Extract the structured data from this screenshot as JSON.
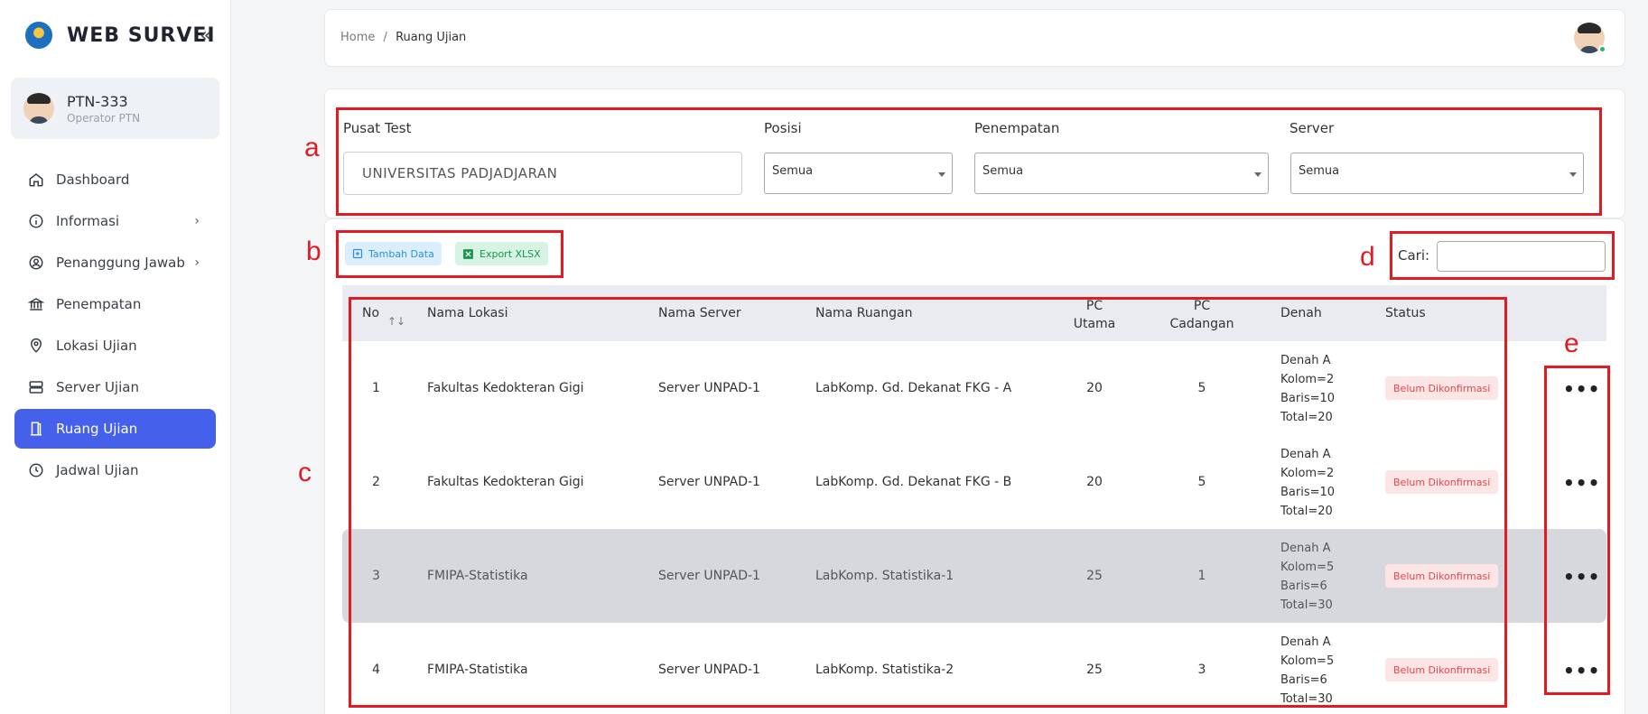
{
  "app": {
    "title": "WEB SURVEI",
    "collapse_icon": "chevrons-left-icon"
  },
  "user": {
    "name": "PTN-333",
    "role": "Operator PTN"
  },
  "nav": [
    {
      "label": "Dashboard",
      "icon": "home-icon",
      "active": false,
      "has_chevron": false
    },
    {
      "label": "Informasi",
      "icon": "info-icon",
      "active": false,
      "has_chevron": true
    },
    {
      "label": "Penanggung Jawab",
      "icon": "user-circle-icon",
      "active": false,
      "has_chevron": true
    },
    {
      "label": "Penempatan",
      "icon": "bank-icon",
      "active": false,
      "has_chevron": false
    },
    {
      "label": "Lokasi Ujian",
      "icon": "map-pin-icon",
      "active": false,
      "has_chevron": false
    },
    {
      "label": "Server Ujian",
      "icon": "server-icon",
      "active": false,
      "has_chevron": false
    },
    {
      "label": "Ruang Ujian",
      "icon": "door-icon",
      "active": true,
      "has_chevron": false
    },
    {
      "label": "Jadwal Ujian",
      "icon": "clock-icon",
      "active": false,
      "has_chevron": false
    }
  ],
  "breadcrumb": {
    "home": "Home",
    "separator": "/",
    "current": "Ruang Ujian"
  },
  "filters": {
    "pusat_test": {
      "label": "Pusat Test",
      "value": "UNIVERSITAS PADJADJARAN"
    },
    "posisi": {
      "label": "Posisi",
      "value": "Semua"
    },
    "penempatan": {
      "label": "Penempatan",
      "value": "Semua"
    },
    "server": {
      "label": "Server",
      "value": "Semua"
    }
  },
  "toolbar": {
    "add_label": "Tambah Data",
    "export_label": "Export XLSX",
    "search_label": "Cari:",
    "search_value": ""
  },
  "table": {
    "headers": {
      "no": "No",
      "nama_lokasi": "Nama Lokasi",
      "nama_server": "Nama Server",
      "nama_ruangan": "Nama Ruangan",
      "pc_utama": "PC\nUtama",
      "pc_cadangan": "PC\nCadangan",
      "denah": "Denah",
      "status": "Status"
    },
    "rows": [
      {
        "no": "1",
        "lokasi": "Fakultas Kedokteran Gigi",
        "server": "Server UNPAD-1",
        "ruangan": "LabKomp. Gd. Dekanat FKG - A",
        "pc_utama": "20",
        "pc_cadangan": "5",
        "denah": [
          "Denah A",
          "Kolom=2",
          "Baris=10",
          "Total=20"
        ],
        "status": "Belum Dikonfirmasi"
      },
      {
        "no": "2",
        "lokasi": "Fakultas Kedokteran Gigi",
        "server": "Server UNPAD-1",
        "ruangan": "LabKomp. Gd. Dekanat FKG - B",
        "pc_utama": "20",
        "pc_cadangan": "5",
        "denah": [
          "Denah A",
          "Kolom=2",
          "Baris=10",
          "Total=20"
        ],
        "status": "Belum Dikonfirmasi"
      },
      {
        "no": "3",
        "lokasi": "FMIPA-Statistika",
        "server": "Server UNPAD-1",
        "ruangan": "LabKomp. Statistika-1",
        "pc_utama": "25",
        "pc_cadangan": "1",
        "denah": [
          "Denah A",
          "Kolom=5",
          "Baris=6",
          "Total=30"
        ],
        "status": "Belum Dikonfirmasi"
      },
      {
        "no": "4",
        "lokasi": "FMIPA-Statistika",
        "server": "Server UNPAD-1",
        "ruangan": "LabKomp. Statistika-2",
        "pc_utama": "25",
        "pc_cadangan": "3",
        "denah": [
          "Denah A",
          "Kolom=5",
          "Baris=6",
          "Total=30"
        ],
        "status": "Belum Dikonfirmasi"
      }
    ],
    "action_label": "•••"
  },
  "annotations": {
    "a": "a",
    "b": "b",
    "c": "c",
    "d": "d",
    "e": "e"
  },
  "colors": {
    "accent": "#4561ec",
    "annotation": "#e21b23",
    "badge_text": "#e0494f",
    "badge_bg": "#fde5e5"
  }
}
